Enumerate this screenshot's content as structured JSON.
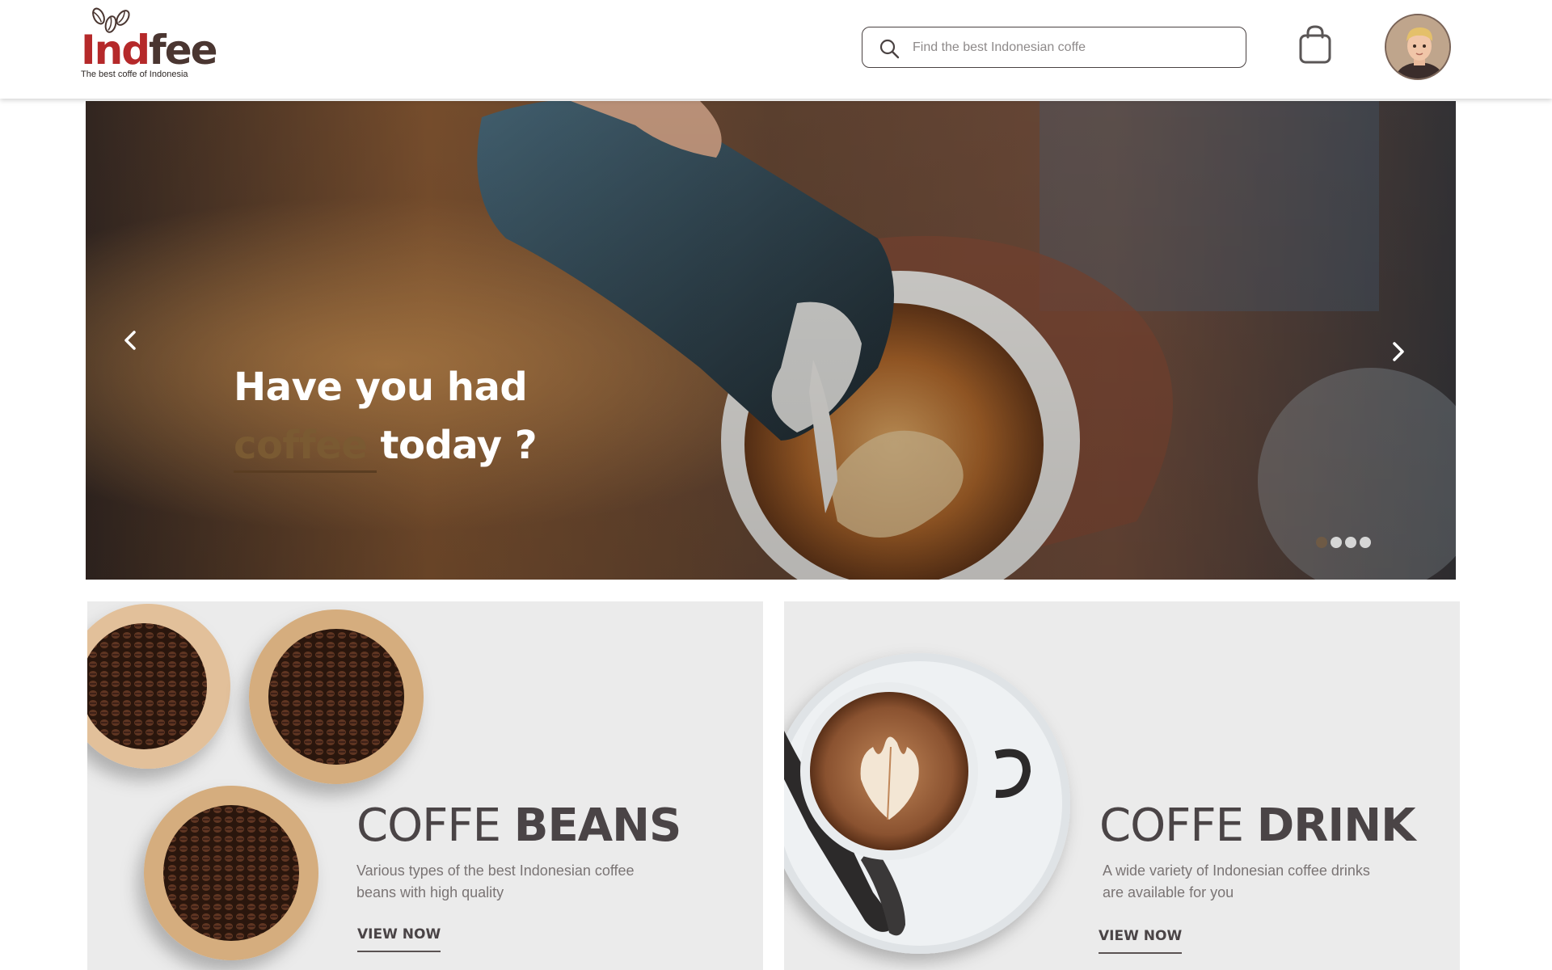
{
  "brand": {
    "name_part1": "Ind",
    "name_part2": "fee",
    "tagline": "The best coffe of Indonesia",
    "colors": {
      "red": "#b5292a",
      "brown": "#4a3631"
    }
  },
  "header": {
    "search": {
      "placeholder": "Find the best Indonesian coffe",
      "icon": "search-icon"
    },
    "cart_icon": "shopping-bag-icon",
    "avatar_icon": "user-avatar"
  },
  "hero": {
    "title_line1": "Have you had",
    "title_accent": "coffee",
    "title_rest": " today ?",
    "accent_color": "#7a5a32",
    "prev_icon": "chevron-left-icon",
    "next_icon": "chevron-right-icon",
    "slides_count": 4,
    "active_slide": 1
  },
  "cards": [
    {
      "title_light": "COFFE ",
      "title_bold": "BEANS",
      "description": "Various types of the best Indonesian coffee beans with high quality",
      "cta": "VIEW NOW"
    },
    {
      "title_light": "COFFE ",
      "title_bold": "DRINK",
      "description": "A wide variety of Indonesian coffee drinks are available for you",
      "cta": "VIEW NOW"
    }
  ]
}
